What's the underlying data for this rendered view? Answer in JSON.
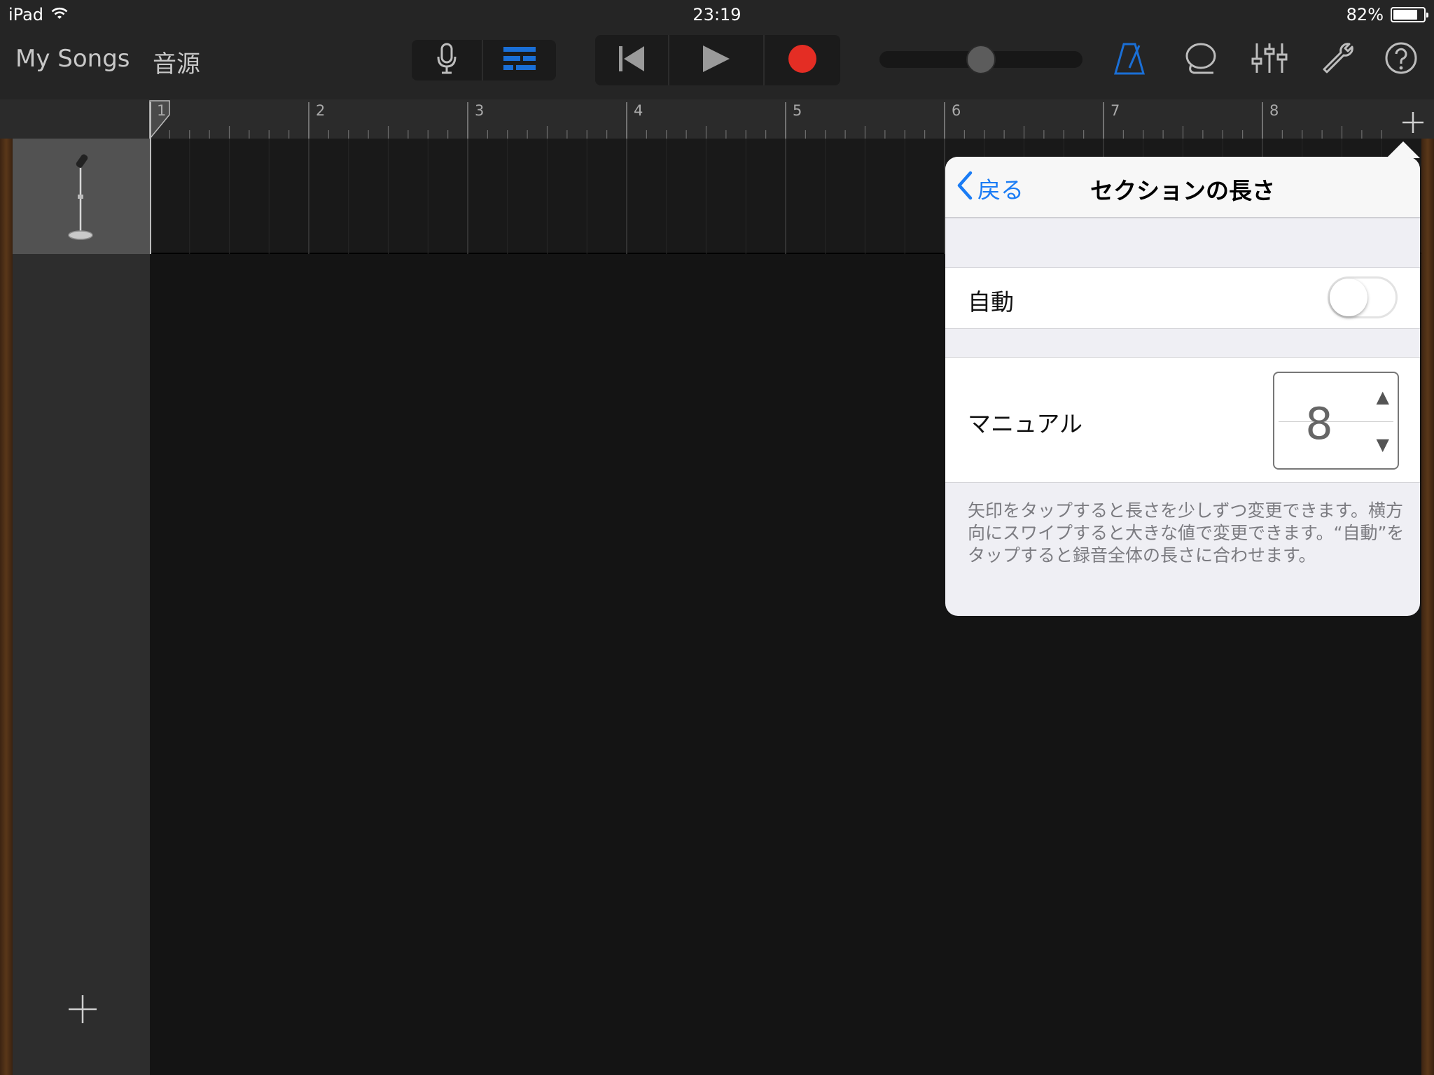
{
  "status_bar": {
    "device": "iPad",
    "time": "23:19",
    "battery_percent": "82%",
    "battery_level": 0.82,
    "wifi_icon": "wifi-icon"
  },
  "toolbar": {
    "my_songs_label": "My Songs",
    "instruments_label": "音源",
    "accent_color": "#1a6fd6",
    "record_color": "#e42d24",
    "master_volume_level": 0.5
  },
  "ruler": {
    "bars": [
      "1",
      "2",
      "3",
      "4",
      "5",
      "6",
      "7",
      "8"
    ]
  },
  "popover": {
    "back_label": "戻る",
    "title": "セクションの長さ",
    "auto_label": "自動",
    "auto_on": false,
    "manual_label": "マニュアル",
    "manual_value": "8",
    "stepper_up": "▲",
    "stepper_down": "▼",
    "footnote": "矢印をタップすると長さを少しずつ変更できます。横方向にスワイプすると大きな値で変更できます。“自動”をタップすると録音全体の長さに合わせます。"
  }
}
